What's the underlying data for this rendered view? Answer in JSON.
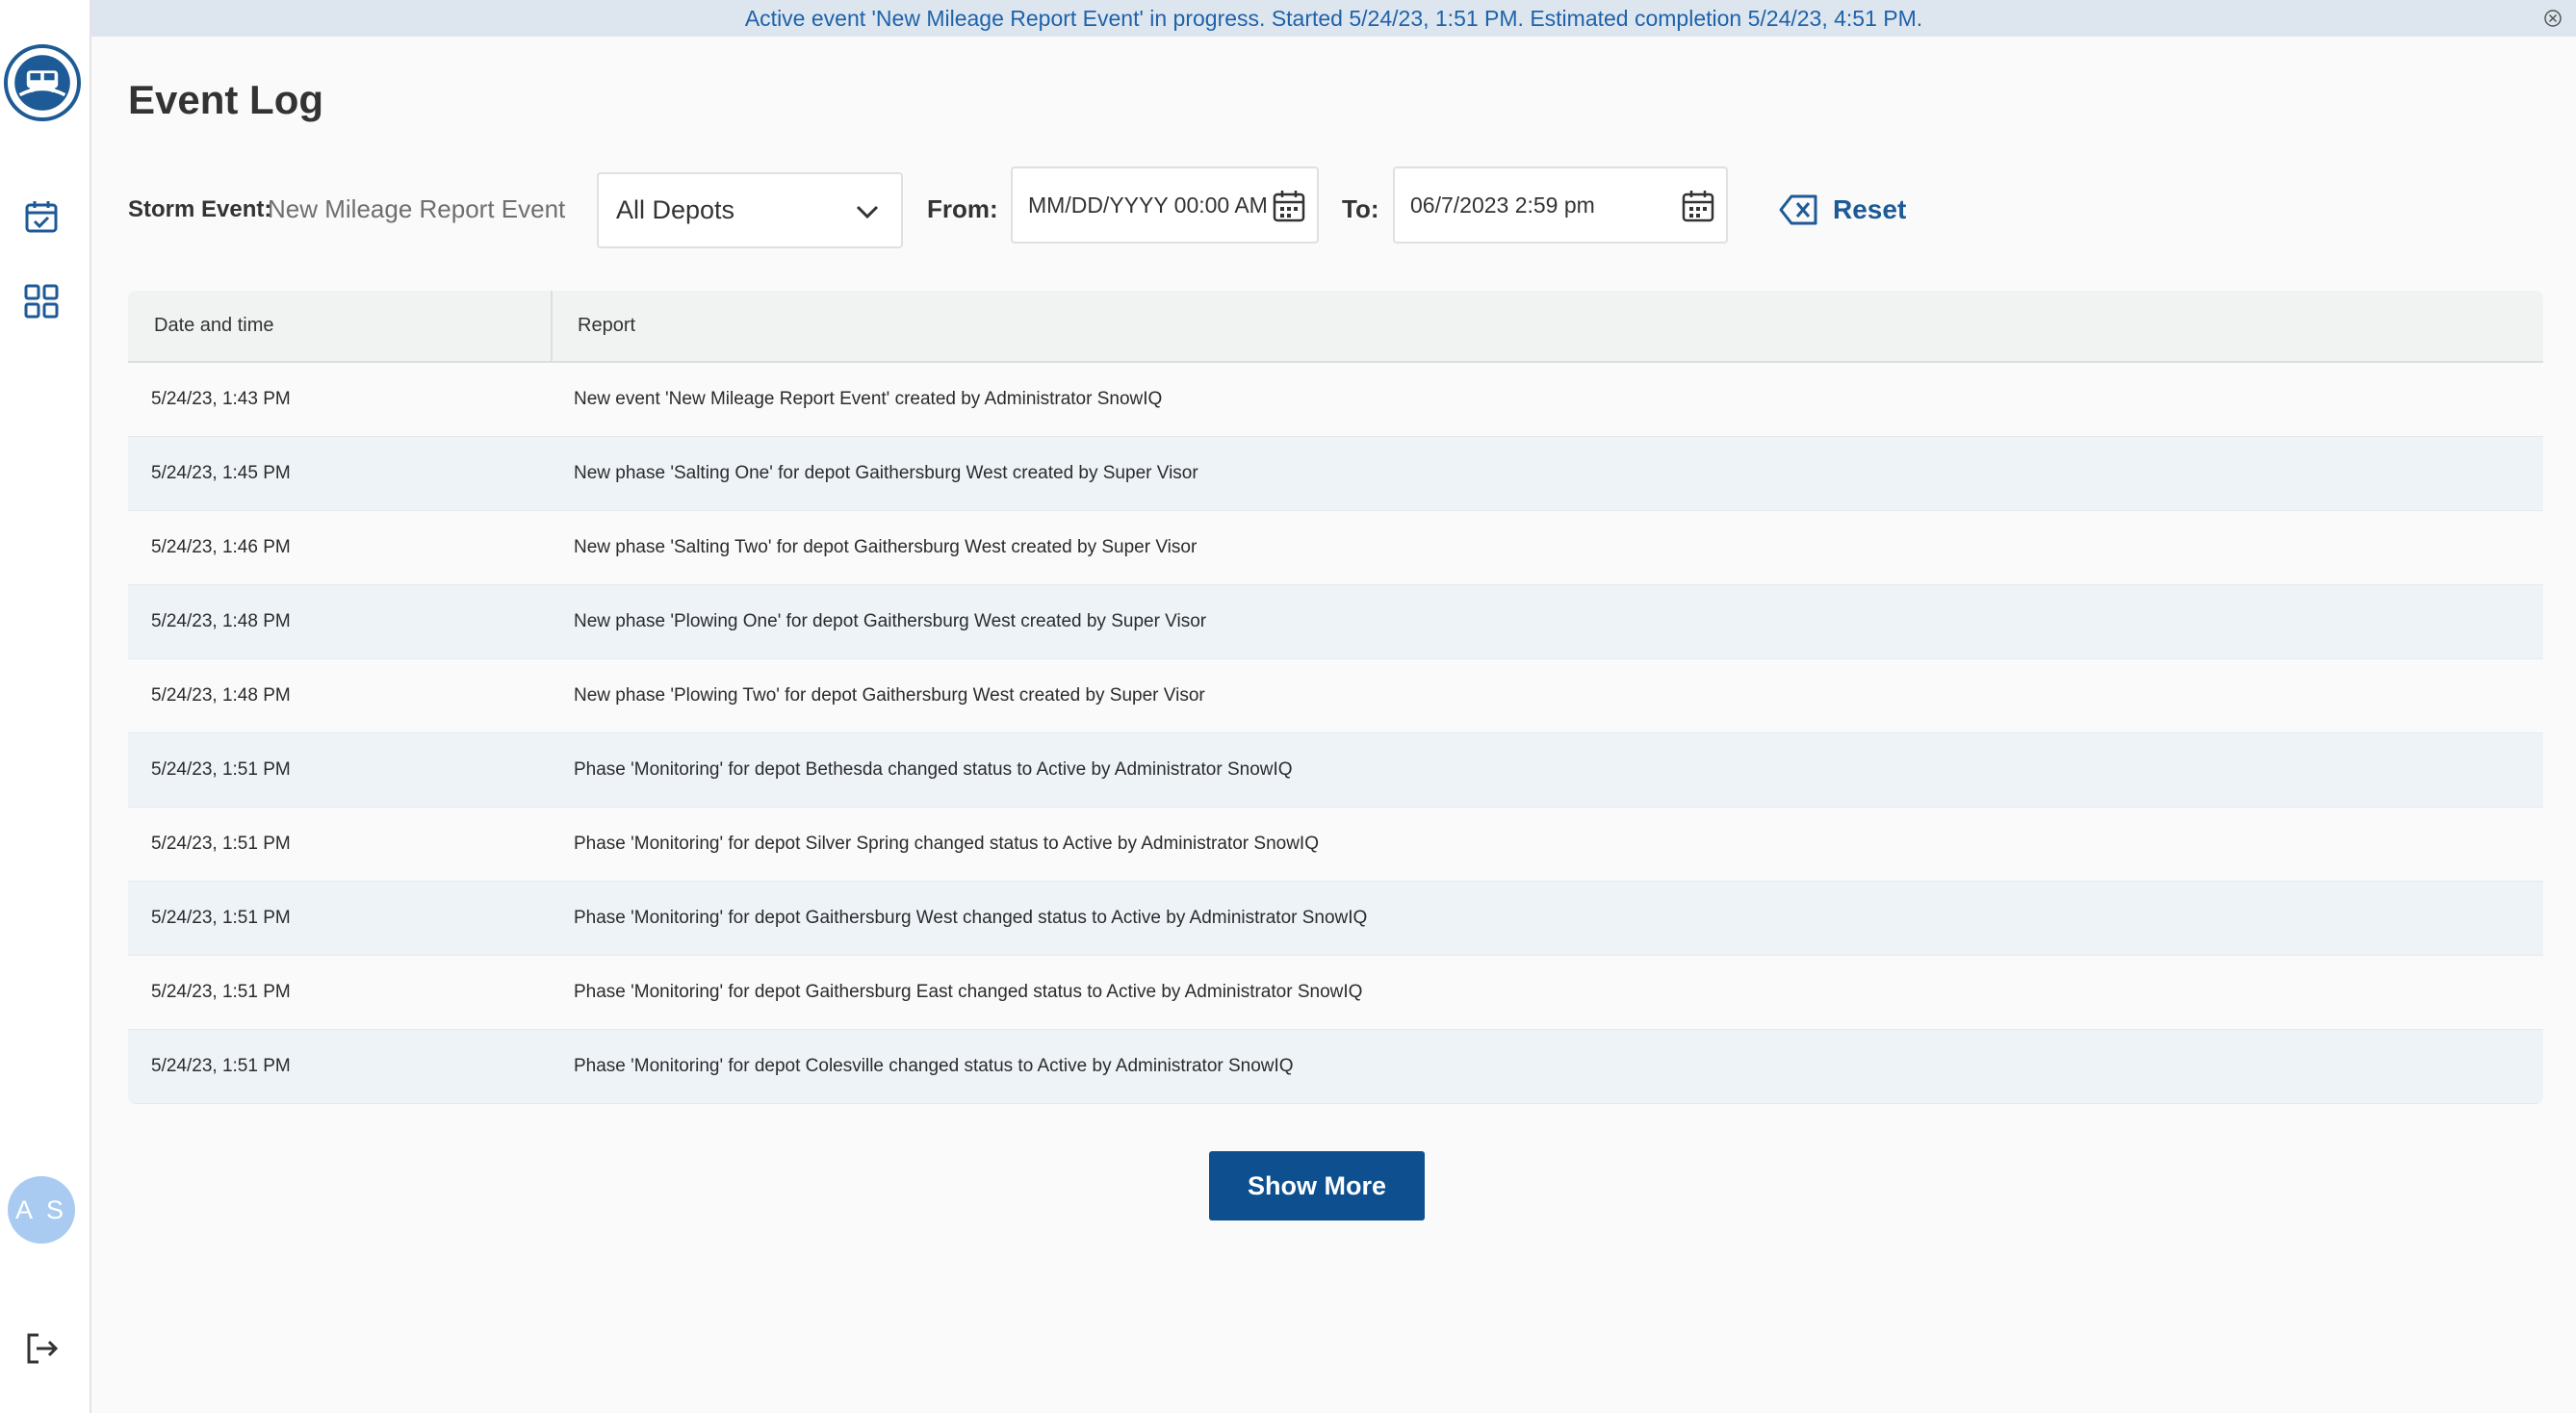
{
  "banner": {
    "message": "Active event 'New Mileage Report Event' in progress. Started 5/24/23, 1:51 PM. Estimated completion 5/24/23, 4:51 PM."
  },
  "sidebar": {
    "icons": [
      "app-logo",
      "calendar-check-icon",
      "dashboard-grid-icon",
      "logout-icon"
    ],
    "user_initials": "A S"
  },
  "page": {
    "title": "Event Log"
  },
  "filters": {
    "storm_event_label": "Storm Event:",
    "storm_event_value": "New Mileage Report Event",
    "depot_selected": "All Depots",
    "from_label": "From:",
    "from_placeholder": "MM/DD/YYYY 00:00 AM",
    "from_value": "",
    "to_label": "To:",
    "to_value": "06/7/2023 2:59 pm",
    "reset_label": "Reset"
  },
  "table": {
    "headers": [
      "Date and time",
      "Report"
    ],
    "rows": [
      {
        "time": "5/24/23, 1:43 PM",
        "report": "New event 'New Mileage Report Event' created by Administrator SnowIQ"
      },
      {
        "time": "5/24/23, 1:45 PM",
        "report": "New phase 'Salting One' for depot Gaithersburg West created by Super Visor"
      },
      {
        "time": "5/24/23, 1:46 PM",
        "report": "New phase 'Salting Two' for depot Gaithersburg West created by Super Visor"
      },
      {
        "time": "5/24/23, 1:48 PM",
        "report": "New phase 'Plowing One' for depot Gaithersburg West created by Super Visor"
      },
      {
        "time": "5/24/23, 1:48 PM",
        "report": "New phase 'Plowing Two' for depot Gaithersburg West created by Super Visor"
      },
      {
        "time": "5/24/23, 1:51 PM",
        "report": "Phase 'Monitoring' for depot Bethesda changed status to Active by Administrator SnowIQ"
      },
      {
        "time": "5/24/23, 1:51 PM",
        "report": "Phase 'Monitoring' for depot Silver Spring changed status to Active by Administrator SnowIQ"
      },
      {
        "time": "5/24/23, 1:51 PM",
        "report": "Phase 'Monitoring' for depot Gaithersburg West changed status to Active by Administrator SnowIQ"
      },
      {
        "time": "5/24/23, 1:51 PM",
        "report": "Phase 'Monitoring' for depot Gaithersburg East changed status to Active by Administrator SnowIQ"
      },
      {
        "time": "5/24/23, 1:51 PM",
        "report": "Phase 'Monitoring' for depot Colesville changed status to Active by Administrator SnowIQ"
      }
    ]
  },
  "actions": {
    "show_more_label": "Show More"
  },
  "colors": {
    "brand": "#0d4f8f",
    "accent": "#1e62a9",
    "banner_bg": "#dde6ef",
    "row_alt": "#eef3f8"
  }
}
